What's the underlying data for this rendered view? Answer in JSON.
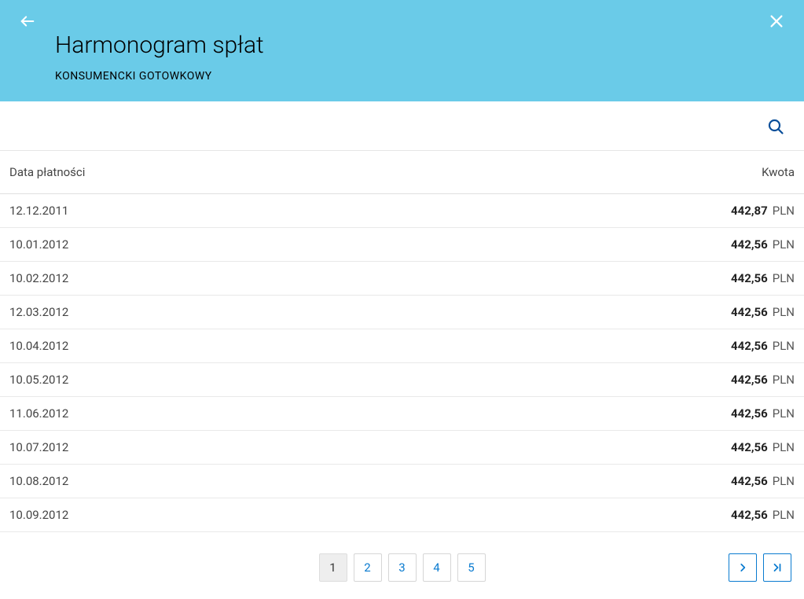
{
  "header": {
    "title": "Harmonogram spłat",
    "subtitle": "KONSUMENCKI GOTOWKOWY"
  },
  "table": {
    "columns": {
      "date": "Data płatności",
      "amount": "Kwota"
    },
    "currency": "PLN",
    "rows": [
      {
        "date": "12.12.2011",
        "amount": "442,87"
      },
      {
        "date": "10.01.2012",
        "amount": "442,56"
      },
      {
        "date": "10.02.2012",
        "amount": "442,56"
      },
      {
        "date": "12.03.2012",
        "amount": "442,56"
      },
      {
        "date": "10.04.2012",
        "amount": "442,56"
      },
      {
        "date": "10.05.2012",
        "amount": "442,56"
      },
      {
        "date": "11.06.2012",
        "amount": "442,56"
      },
      {
        "date": "10.07.2012",
        "amount": "442,56"
      },
      {
        "date": "10.08.2012",
        "amount": "442,56"
      },
      {
        "date": "10.09.2012",
        "amount": "442,56"
      }
    ]
  },
  "pagination": {
    "pages": [
      "1",
      "2",
      "3",
      "4",
      "5"
    ],
    "current": "1"
  }
}
